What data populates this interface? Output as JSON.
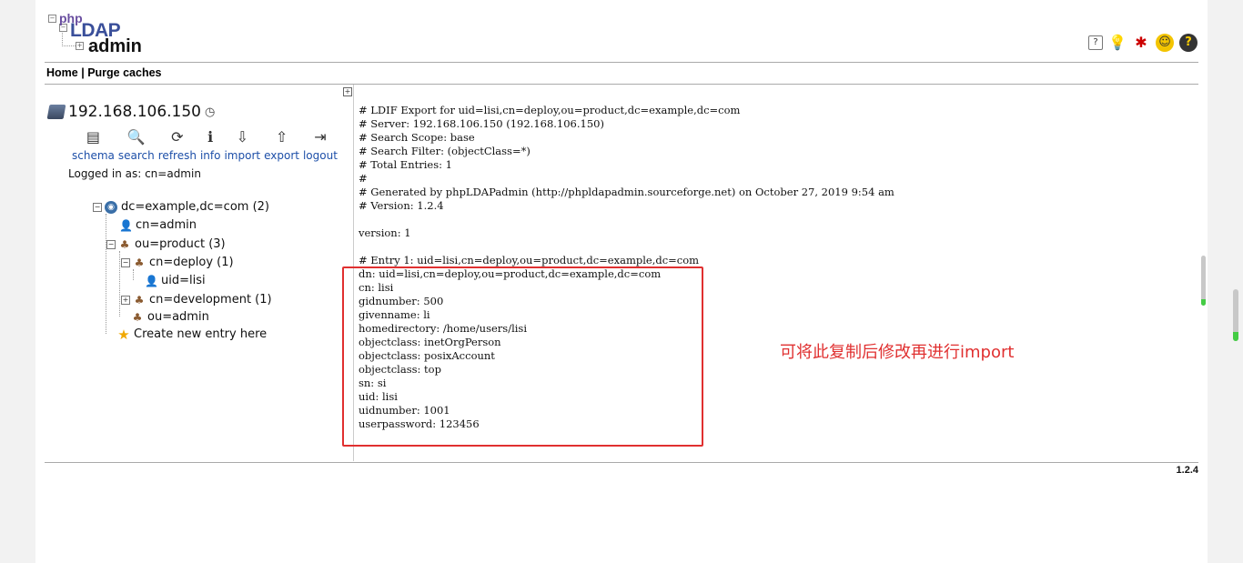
{
  "logo": {
    "line1": "php",
    "line2": "LDAP",
    "line3": "admin"
  },
  "header_icons": [
    "help-icon",
    "bulb-icon",
    "bug-icon",
    "smile-icon",
    "question-icon"
  ],
  "menu": {
    "home": "Home",
    "sep": "|",
    "purge": "Purge caches"
  },
  "server": {
    "name": "192.168.106.150"
  },
  "tools": [
    {
      "label": "schema",
      "icon": "schema-icon",
      "glyph": "▤"
    },
    {
      "label": "search",
      "icon": "search-icon",
      "glyph": "🔍"
    },
    {
      "label": "refresh",
      "icon": "refresh-icon",
      "glyph": "⟳"
    },
    {
      "label": "info",
      "icon": "info-icon",
      "glyph": "ℹ"
    },
    {
      "label": "import",
      "icon": "import-icon",
      "glyph": "⇩"
    },
    {
      "label": "export",
      "icon": "export-icon",
      "glyph": "⇧"
    },
    {
      "label": "logout",
      "icon": "logout-icon",
      "glyph": "⇥"
    }
  ],
  "logged_in": "Logged in as: cn=admin",
  "tree": {
    "root": "dc=example,dc=com (2)",
    "cn_admin": "cn=admin",
    "ou_product": "ou=product (3)",
    "cn_deploy": "cn=deploy (1)",
    "uid_lisi": "uid=lisi",
    "cn_development": "cn=development (1)",
    "ou_admin": "ou=admin",
    "create_new": "Create new entry here"
  },
  "ldif_lines": [
    "# LDIF Export for uid=lisi,cn=deploy,ou=product,dc=example,dc=com",
    "# Server: 192.168.106.150 (192.168.106.150)",
    "# Search Scope: base",
    "# Search Filter: (objectClass=*)",
    "# Total Entries: 1",
    "#",
    "# Generated by phpLDAPadmin (http://phpldapadmin.sourceforge.net) on October 27, 2019 9:54 am",
    "# Version: 1.2.4",
    "",
    "version: 1",
    "",
    "# Entry 1: uid=lisi,cn=deploy,ou=product,dc=example,dc=com",
    "dn: uid=lisi,cn=deploy,ou=product,dc=example,dc=com",
    "cn: lisi",
    "gidnumber: 500",
    "givenname: li",
    "homedirectory: /home/users/lisi",
    "objectclass: inetOrgPerson",
    "objectclass: posixAccount",
    "objectclass: top",
    "sn: si",
    "uid: lisi",
    "uidnumber: 1001",
    "userpassword: 123456"
  ],
  "annotation": "可将此复制后修改再进行import",
  "version": "1.2.4",
  "colors": {
    "annotation": "#e03030",
    "link": "#1d4fa8"
  }
}
